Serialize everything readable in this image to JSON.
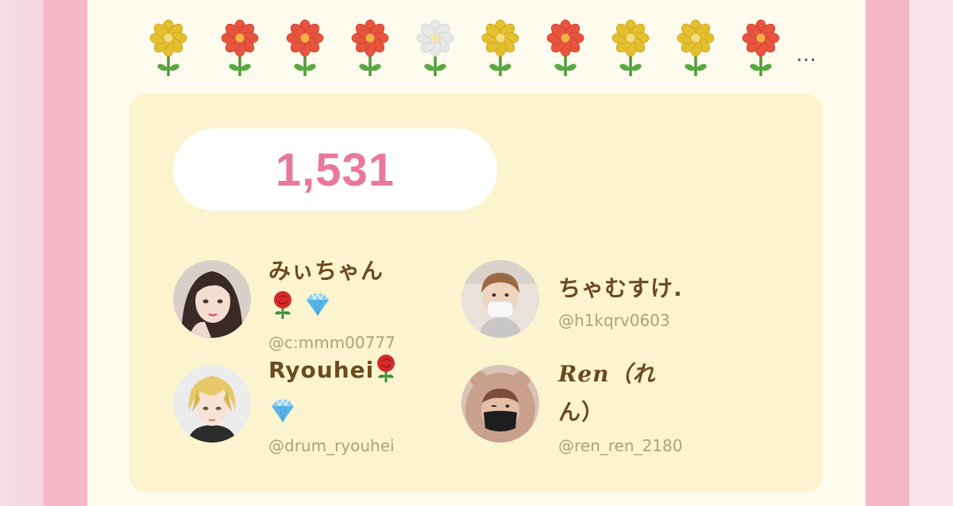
{
  "flowers": [
    {
      "icon": "yellow-flower-icon",
      "petal_color": "#e4bf2e"
    },
    {
      "icon": "red-flower-icon",
      "petal_color": "#e8553f"
    },
    {
      "icon": "red-flower-icon",
      "petal_color": "#e8553f"
    },
    {
      "icon": "red-flower-icon",
      "petal_color": "#e8553f"
    },
    {
      "icon": "white-flower-icon",
      "petal_color": "#e7e7e7"
    },
    {
      "icon": "yellow-flower-icon",
      "petal_color": "#e4bf2e"
    },
    {
      "icon": "red-flower-icon",
      "petal_color": "#e8553f"
    },
    {
      "icon": "yellow-flower-icon",
      "petal_color": "#e4bf2e"
    },
    {
      "icon": "yellow-flower-icon",
      "petal_color": "#e4bf2e"
    },
    {
      "icon": "red-flower-icon",
      "petal_color": "#e8553f"
    }
  ],
  "more_indicator": "…",
  "count": "1,531",
  "colors": {
    "count_text": "#e8799c",
    "name_text": "#6b4a22",
    "handle_text": "#b09f7c",
    "panel_bg": "#fcf4cf",
    "border_pink": "#f4b9c9"
  },
  "users": [
    {
      "name": "みぃちゃん",
      "badges": [
        "rose-icon",
        "gem-icon"
      ],
      "handle": "@c:mmm00777",
      "avatar": "avatar-anime-girl"
    },
    {
      "name": "ちゃむすけ.",
      "badges": [],
      "handle": "@h1kqrv0603",
      "avatar": "avatar-masked-boy"
    },
    {
      "name": "Ryouhei",
      "badges": [
        "rose-icon",
        "gem-icon"
      ],
      "handle": "@drum_ryouhei",
      "avatar": "avatar-blond-anime"
    },
    {
      "name_line1": "Ren（れ",
      "name_line2": "ん）",
      "badges": [],
      "handle": "@ren_ren_2180",
      "avatar": "avatar-bear-hood"
    }
  ]
}
